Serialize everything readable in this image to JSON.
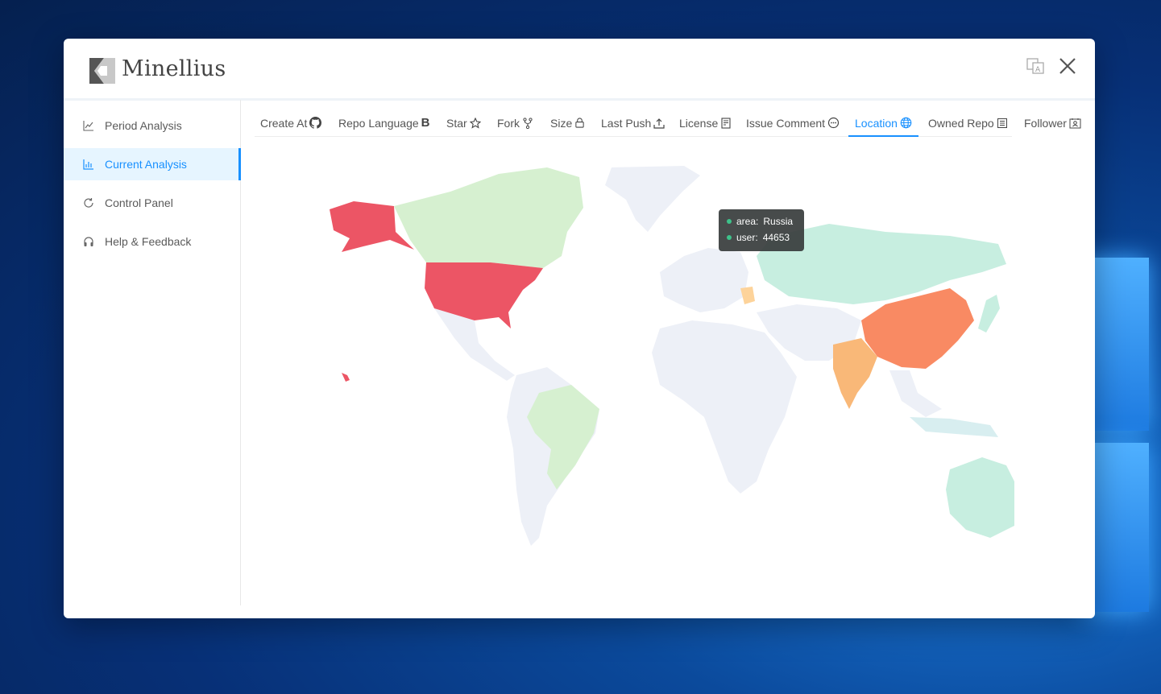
{
  "app": {
    "title": "Minellius"
  },
  "sidebar": {
    "items": [
      {
        "label": "Period Analysis",
        "icon": "line-chart-icon",
        "active": false
      },
      {
        "label": "Current Analysis",
        "icon": "bar-chart-icon",
        "active": true
      },
      {
        "label": "Control Panel",
        "icon": "sync-icon",
        "active": false
      },
      {
        "label": "Help & Feedback",
        "icon": "headphones-icon",
        "active": false
      }
    ]
  },
  "tabs": [
    {
      "label": "Create At",
      "icon": "github-icon"
    },
    {
      "label": "Repo Language",
      "icon": "bold-b-icon"
    },
    {
      "label": "Star",
      "icon": "star-icon"
    },
    {
      "label": "Fork",
      "icon": "fork-icon"
    },
    {
      "label": "Size",
      "icon": "lock-icon"
    },
    {
      "label": "Last Push",
      "icon": "upload-icon"
    },
    {
      "label": "License",
      "icon": "license-icon"
    },
    {
      "label": "Issue Comment",
      "icon": "comment-icon"
    },
    {
      "label": "Location",
      "icon": "globe-icon",
      "active": true
    },
    {
      "label": "Owned Repo",
      "icon": "list-icon"
    },
    {
      "label": "Follower",
      "icon": "contacts-icon"
    }
  ],
  "tooltip": {
    "area_label": "area:",
    "area_value": "Russia",
    "user_label": "user:",
    "user_value": "44653"
  },
  "colors": {
    "accent": "#1890ff",
    "usa": "#ec5565",
    "china": "#f98a63",
    "india": "#f9b878",
    "germany": "#fdd39a",
    "russia": "#c7eee0",
    "canada_brazil": "#d6f0d0",
    "default_country": "#edf0f7"
  }
}
